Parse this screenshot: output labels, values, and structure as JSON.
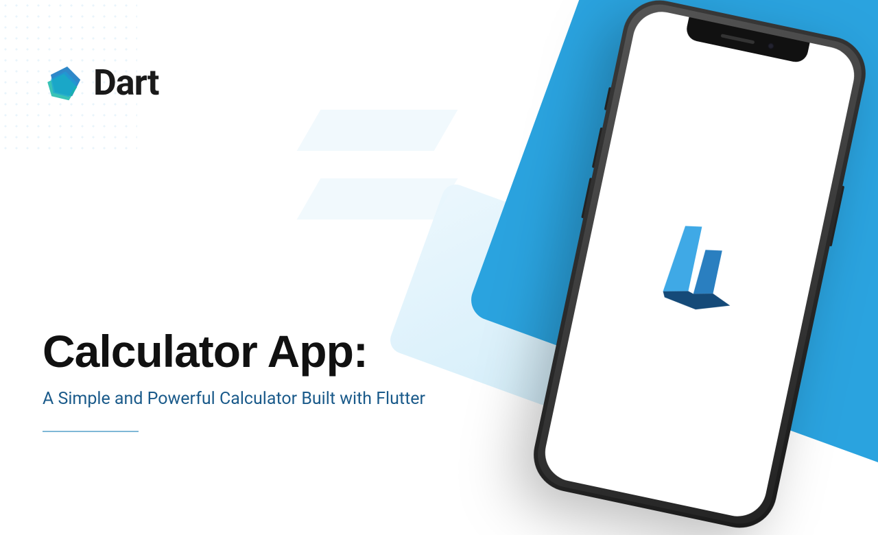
{
  "logo": {
    "name": "Dart"
  },
  "title": {
    "main": "Calculator App:",
    "sub": "A Simple and Powerful Calculator Built with Flutter"
  },
  "colors": {
    "accent": "#2aa3df",
    "subtitle": "#1a5a8a",
    "dart_teal": "#17b9a9",
    "dart_blue": "#0a73c0"
  }
}
